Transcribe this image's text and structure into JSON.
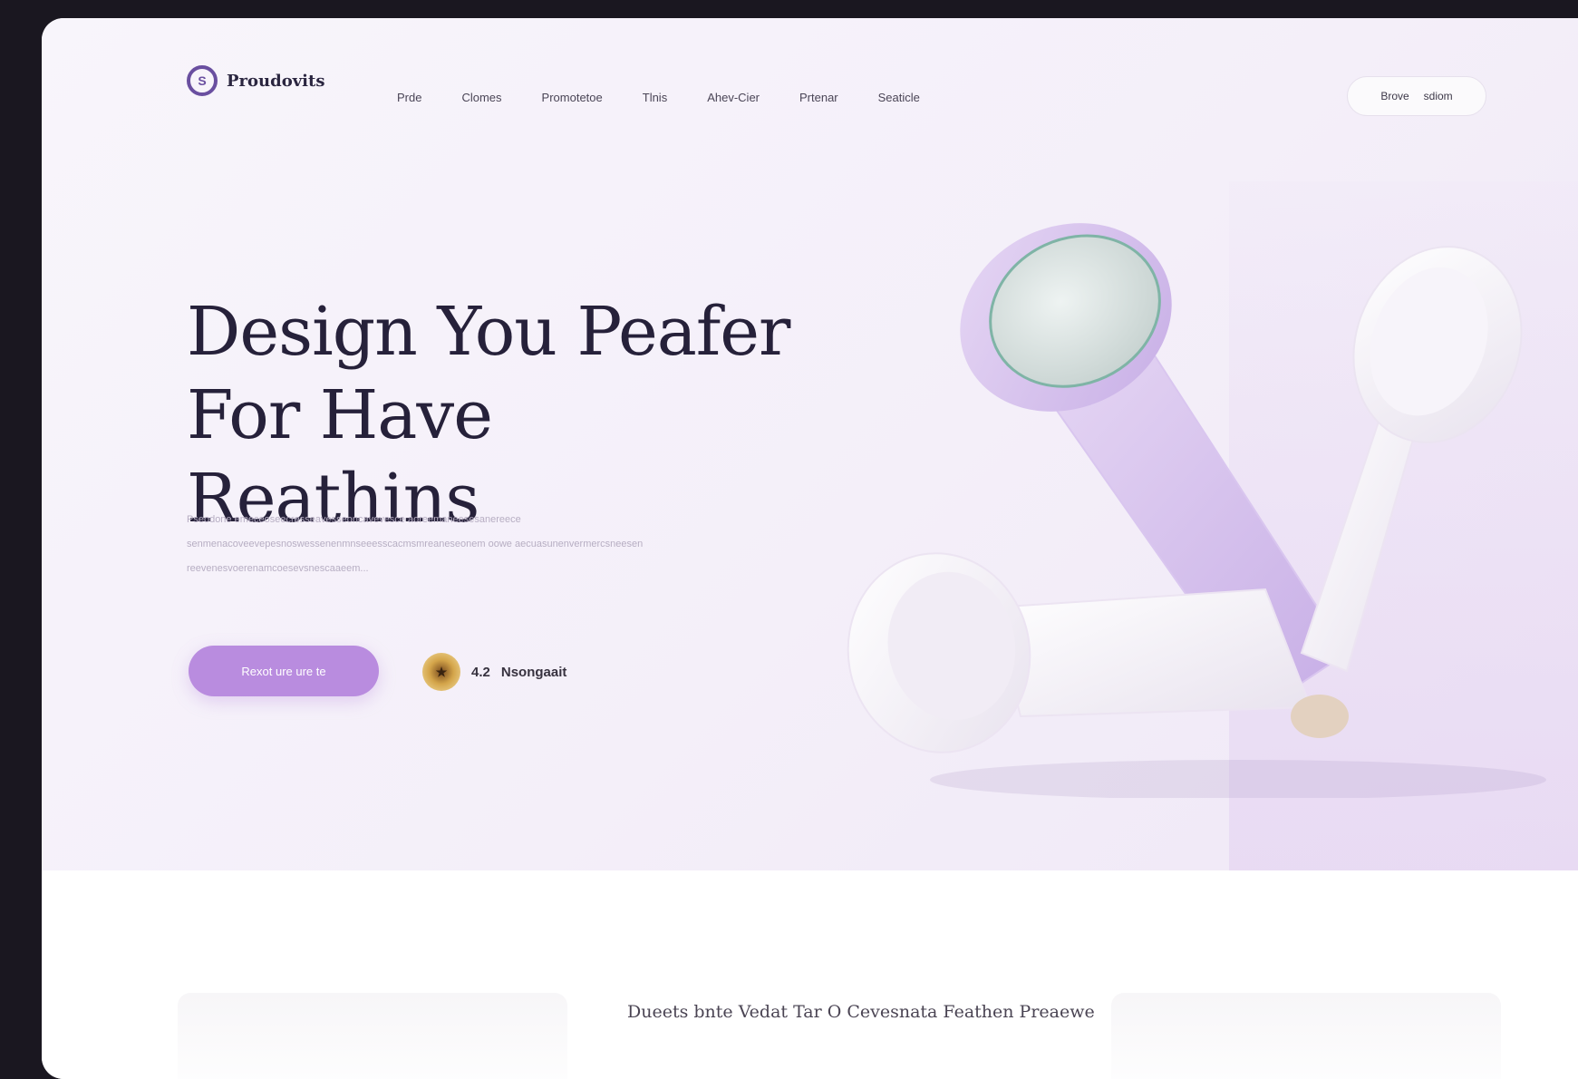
{
  "brand": {
    "name": "Proudovits",
    "mark": "S"
  },
  "nav": {
    "links": [
      "Prde",
      "Clomes",
      "Promotetoe",
      "Tlnis",
      "Ahev-Cier",
      "Prtenar",
      "Seaticle"
    ],
    "cta_primary": "Brove",
    "cta_secondary": "sdiom"
  },
  "hero": {
    "headline_line1": "Design You Peafer",
    "headline_line2": "For Have Reathins",
    "body": "Pseodone emeceoseecresseavesseoncavevesce aoreemaneesesanereece senmenacoveevepesnoswessenenmnseeesscacmsmreaneseonem oowe aecuasunenvermercsneesen reevenesvoerenamcoesevsnescaaeem...",
    "primary_button": "Rexot ure ure te",
    "rating_value": "4.2",
    "rating_label": "Nsongaait"
  },
  "section": {
    "heading": "Dueets bnte Vedat Tar O Cevesnata Feathen Preaewe"
  },
  "colors": {
    "accent": "#b98cdf",
    "headline": "#26213a",
    "hero_bg": "#f4eff9"
  }
}
